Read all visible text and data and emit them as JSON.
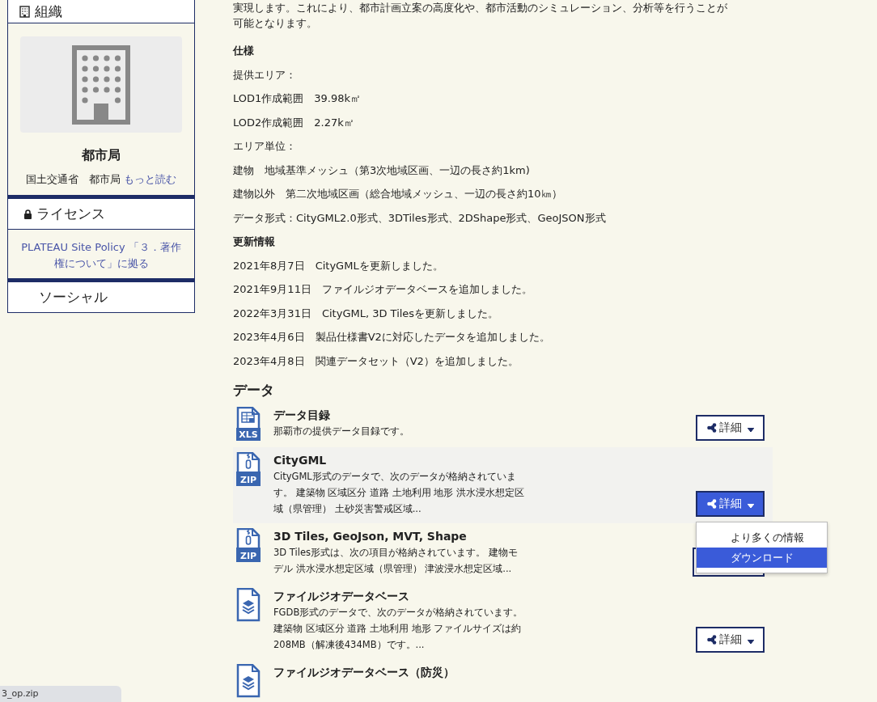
{
  "sidebar": {
    "organization": {
      "heading": "組織",
      "name": "都市局",
      "description": "国土交通省　都市局",
      "more_link": "もっと読む"
    },
    "license": {
      "heading": "ライセンス",
      "text": "PLATEAU Site Policy 「３．著作権について」に拠る"
    },
    "social": {
      "heading": "ソーシャル"
    }
  },
  "content": {
    "intro_lines": [
      "実現します。これにより、都市計画立案の高度化や、都市活動のシミュレーション、分析等を行うことが",
      "可能となります。"
    ],
    "spec_heading": "仕様",
    "spec_lines": [
      "提供エリア：",
      "LOD1作成範囲　39.98k㎡",
      "LOD2作成範囲　2.27k㎡",
      "エリア単位：",
      "建物　地域基準メッシュ（第3次地域区画、一辺の長さ約1km)",
      "建物以外　第二次地域区画（総合地域メッシュ、一辺の長さ約10㎞）",
      "データ形式：CityGML2.0形式、3DTiles形式、2DShape形式、GeoJSON形式"
    ],
    "update_heading": "更新情報",
    "update_lines": [
      "2021年8月7日　CityGMLを更新しました。",
      "2021年9月11日　ファイルジオデータベースを追加しました。",
      "2022年3月31日　CityGML, 3D Tilesを更新しました。",
      "2023年4月6日　製品仕様書V2に対応したデータを追加しました。",
      "2023年4月8日　関連データセット（V2）を追加しました。"
    ],
    "data_heading": "データ",
    "data_items": [
      {
        "kind": "xls",
        "icon_label": "XLS",
        "title": "データ目録",
        "description": "那覇市の提供データ目録です。",
        "button": "詳細",
        "highlighted": false
      },
      {
        "kind": "zip",
        "icon_label": "ZIP",
        "title": "CityGML",
        "description": "CityGML形式のデータで、次のデータが格納されています。 建築物 区域区分 道路 土地利用 地形 洪水浸水想定区域（県管理） 土砂災害警戒区域...",
        "button": "詳細",
        "highlighted": true
      },
      {
        "kind": "zip",
        "icon_label": "ZIP",
        "title": "3D Tiles, GeoJson, MVT, Shape",
        "description": "3D Tiles形式は、次の項目が格納されています。 建物モデル 洪水浸水想定区域（県管理） 津波浸水想定区域...",
        "button_covered": true,
        "highlighted": false
      },
      {
        "kind": "db",
        "title": "ファイルジオデータベース",
        "description": "FGDB形式のデータで、次のデータが格納されています。建築物 区域区分 道路 土地利用 地形 ファイルサイズは約208MB（解凍後434MB）です。...",
        "button": "詳細",
        "highlighted": false
      },
      {
        "kind": "db",
        "title": "ファイルジオデータベース（防災）",
        "highlighted": false
      }
    ],
    "dropdown": {
      "items": [
        {
          "label": "より多くの情報",
          "selected": false
        },
        {
          "label": "ダウンロード",
          "selected": true
        }
      ]
    }
  },
  "status_bar": "3_op.zip"
}
